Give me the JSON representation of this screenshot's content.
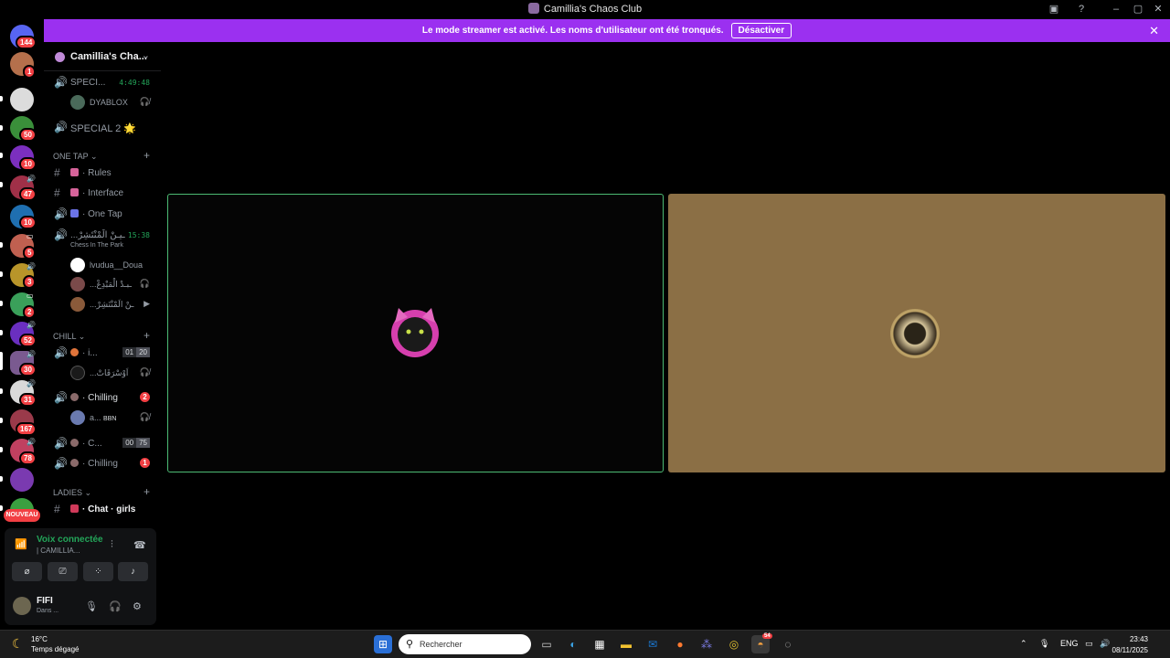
{
  "window": {
    "title": "Camillia's Chaos Club"
  },
  "banner": {
    "message": "Le mode streamer est activé. Les noms d'utilisateur ont été tronqués.",
    "button": "Désactiver"
  },
  "servers": {
    "badges": [
      "144",
      "1",
      "50",
      "10",
      "47",
      "10",
      "5",
      "3",
      "2",
      "52",
      "30",
      "31",
      "167",
      "78"
    ],
    "new_label": "NOUVEAU"
  },
  "guild": {
    "name": "Camillia's Cha..."
  },
  "channels": {
    "special": {
      "name": "SPECI...",
      "time": "4:49:48"
    },
    "special_user": "DYABLOX",
    "special2": "SPECIAL 2 🌟",
    "cat_one_tap": "ONE TAP",
    "rules": "Rules",
    "interface": "Interface",
    "one_tap": "One Tap",
    "chess_channel": {
      "name": "...ـيـنْ الَمْنْتَشِرْ",
      "time": "15:38"
    },
    "chess_activity": "Chess In The Park",
    "chess_users": [
      "lvudua__Doua",
      "...ـبـدْ الْمَبْدِعْ",
      "...ـنْ الَمْنْتَشِرْ"
    ],
    "cat_chill": "CHILL",
    "chill1": {
      "name": "i...",
      "count_a": "01",
      "count_b": "20"
    },
    "chill1_user": "...اَوْسْرَقَاتْ",
    "chilling1": {
      "name": "Chilling",
      "badge": "2"
    },
    "chilling1_user": "a...",
    "chilling1_user_tag": "BBN",
    "c_channel": {
      "name": "C...",
      "count_a": "00",
      "count_b": "75"
    },
    "chilling2": {
      "name": "Chilling",
      "badge": "1"
    },
    "cat_ladies": "LADIES",
    "chat_girls": "Chat · girls"
  },
  "voice": {
    "status": "Voix connectée",
    "channel": "| CAMILLIA...",
    "user_name": "FIFI",
    "user_status": "Dans ..."
  },
  "taskbar": {
    "temp": "16°C",
    "weather": "Temps dégagé",
    "search_placeholder": "Rechercher",
    "lang": "ENG",
    "time": "23:43",
    "date": "08/11/2025",
    "discord_badge": "54"
  }
}
